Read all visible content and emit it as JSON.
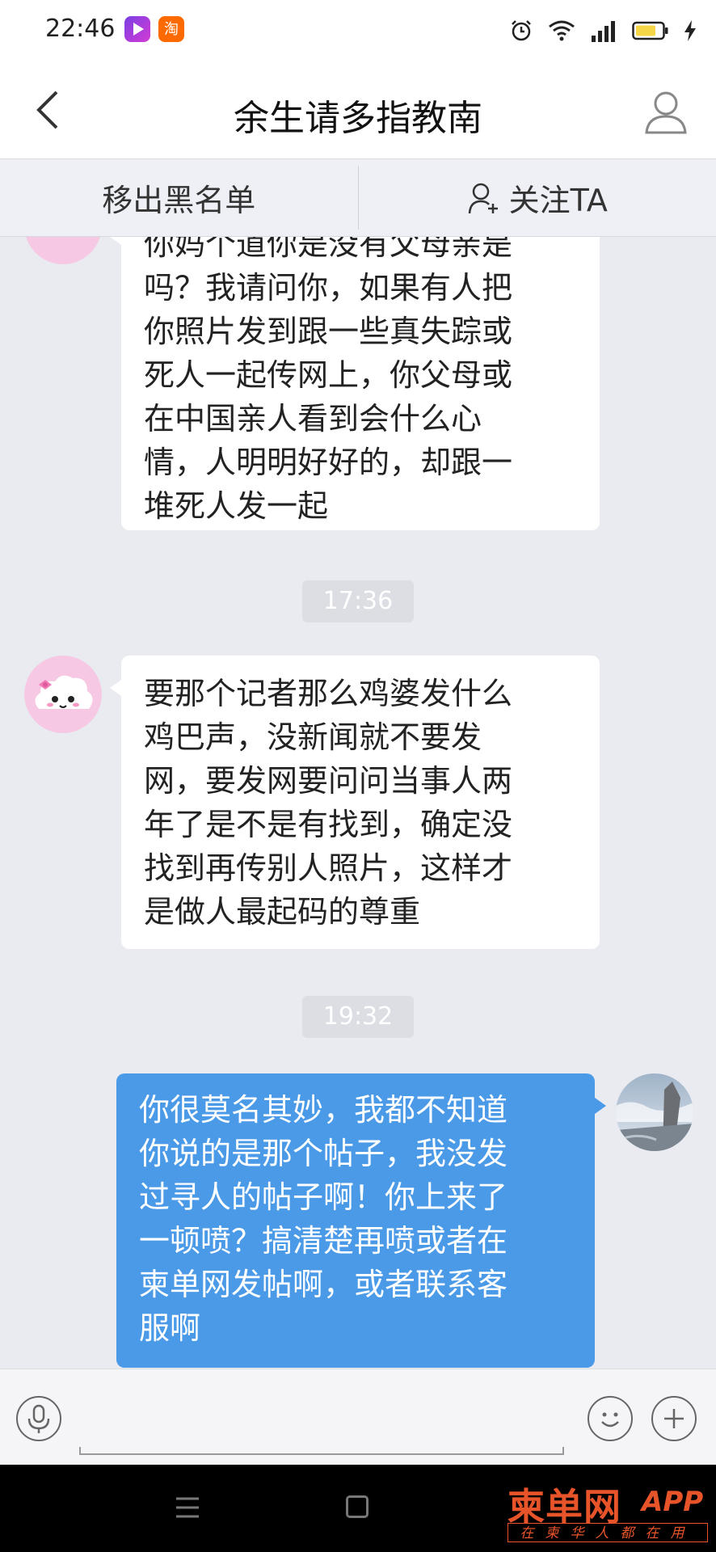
{
  "status_bar": {
    "time": "22:46",
    "left_app_icons": [
      "video-app-icon",
      "taobao-app-icon"
    ],
    "right_icons": [
      "alarm-icon",
      "wifi-icon",
      "signal-icon",
      "battery-icon",
      "charging-icon"
    ]
  },
  "header": {
    "title": "余生请多指教南",
    "back_icon": "chevron-left-icon",
    "profile_icon": "user-icon"
  },
  "action_bar": {
    "remove_blacklist_label": "移出黑名单",
    "follow_label": "关注TA",
    "follow_icon": "user-add-icon"
  },
  "messages": [
    {
      "direction": "incoming",
      "avatar": "cartoon-cloud-avatar",
      "lines": [
        "你妈个道你是没有父母亲是",
        "吗？我请问你，如果有人把",
        "你照片发到跟一些真失踪或",
        "死人一起传网上，你父母或",
        "在中国亲人看到会什么心",
        "情，人明明好好的，却跟一",
        "堆死人发一起"
      ]
    },
    {
      "type": "timestamp",
      "text": "17:36"
    },
    {
      "direction": "incoming",
      "avatar": "cartoon-cloud-avatar",
      "lines": [
        "要那个记者那么鸡婆发什么",
        "鸡巴声，没新闻就不要发",
        "网，要发网要问问当事人两",
        "年了是不是有找到，确定没",
        "找到再传别人照片，这样才",
        "是做人最起码的尊重"
      ]
    },
    {
      "type": "timestamp",
      "text": "19:32"
    },
    {
      "direction": "outgoing",
      "avatar": "landscape-photo-avatar",
      "lines": [
        "你很莫名其妙，我都不知道",
        "你说的是那个帖子，我没发",
        "过寻人的帖子啊！你上来了",
        "一顿喷？搞清楚再喷或者在",
        "柬单网发帖啊，或者联系客",
        "服啊"
      ]
    }
  ],
  "input_bar": {
    "voice_icon": "microphone-icon",
    "emoji_icon": "emoji-icon",
    "more_icon": "plus-icon"
  },
  "nav_bar": {
    "menu_icon": "menu-icon",
    "home_icon": "home-square-icon"
  },
  "watermark": {
    "main": "柬单网",
    "app": "APP",
    "sub": "在柬华人都在用"
  },
  "colors": {
    "outgoing_bubble": "#4a9ae8",
    "incoming_bubble": "#ffffff",
    "chat_background": "#e9ebf0",
    "watermark": "#e8542a"
  }
}
